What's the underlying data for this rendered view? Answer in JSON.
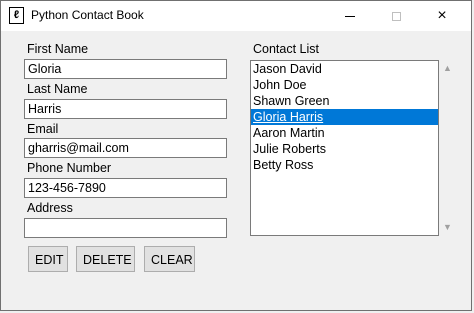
{
  "window": {
    "title": "Python Contact Book",
    "icon": "feather-book-icon",
    "controls": {
      "minimize": "minimize-icon",
      "maximize": "maximize-icon",
      "close": "×"
    }
  },
  "form": {
    "first_name_label": "First Name",
    "first_name_value": "Gloria",
    "last_name_label": "Last Name",
    "last_name_value": "Harris",
    "email_label": "Email",
    "email_value": "gharris@mail.com",
    "phone_label": "Phone Number",
    "phone_value": "123-456-7890",
    "address_label": "Address",
    "address_value": ""
  },
  "contact_list": {
    "label": "Contact List",
    "items": [
      "Jason David",
      "John Doe",
      "Shawn Green",
      "Gloria Harris",
      "Aaron Martin",
      "Julie Roberts",
      "Betty Ross"
    ],
    "selected": "Gloria Harris"
  },
  "buttons": {
    "edit": "EDIT",
    "delete": "DELETE",
    "clear": "CLEAR"
  },
  "colors": {
    "selection": "#0078d7",
    "background": "#f0f0f0"
  }
}
